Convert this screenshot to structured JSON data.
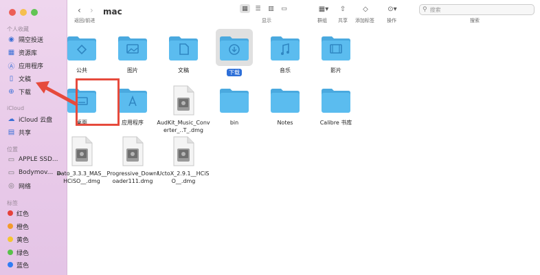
{
  "window": {
    "title": "mac"
  },
  "sidebar": {
    "sections": [
      {
        "label": "个人收藏",
        "items": [
          "隔空投送",
          "资源库",
          "应用程序",
          "文稿",
          "下载"
        ]
      },
      {
        "label": "iCloud",
        "items": [
          "iCloud 云盘",
          "共享"
        ]
      },
      {
        "label": "位置",
        "items": [
          "APPLE SSD...",
          "Bodymov...",
          "网络"
        ]
      },
      {
        "label": "标签",
        "items": [
          "红色",
          "橙色",
          "黄色",
          "绿色",
          "蓝色"
        ]
      }
    ],
    "tag_colors": [
      "#e5413a",
      "#f39a2b",
      "#f5c531",
      "#58c14a",
      "#2f7cf5"
    ]
  },
  "toolbar": {
    "back_label": "返回/前进",
    "view_label": "显示",
    "group_label": "群组",
    "share_label": "共享",
    "tag_label": "添加标签",
    "action_label": "操作",
    "search_label": "搜索",
    "search_placeholder": "搜索"
  },
  "files": [
    {
      "name": "公共",
      "kind": "folder",
      "glyph": "public"
    },
    {
      "name": "图片",
      "kind": "folder",
      "glyph": "pictures"
    },
    {
      "name": "文稿",
      "kind": "folder",
      "glyph": "documents"
    },
    {
      "name": "下载",
      "kind": "folder",
      "glyph": "downloads",
      "selected": true
    },
    {
      "name": "音乐",
      "kind": "folder",
      "glyph": "music"
    },
    {
      "name": "影片",
      "kind": "folder",
      "glyph": "movies"
    },
    {
      "name": "桌面",
      "kind": "folder",
      "glyph": "desktop"
    },
    {
      "name": "应用程序",
      "kind": "folder",
      "glyph": "applications"
    },
    {
      "name": "AudKit_Music_Converter_..T_.dmg",
      "kind": "dmg"
    },
    {
      "name": "bin",
      "kind": "folder",
      "glyph": "none"
    },
    {
      "name": "Notes",
      "kind": "folder",
      "glyph": "none"
    },
    {
      "name": "Calibre 书库",
      "kind": "folder",
      "glyph": "none"
    },
    {
      "name": "Dato_3.3.3_MAS__HCiSO__.dmg",
      "kind": "dmg"
    },
    {
      "name": "Progressive_Downloader111.dmg",
      "kind": "dmg"
    },
    {
      "name": "UctoX_2.9.1__HCiSO__.dmg",
      "kind": "dmg"
    }
  ],
  "colors": {
    "folder": "#5bbcef",
    "folder_tab": "#4aa9df",
    "folder_glyph": "#2f86c2",
    "selection": "#2d6fd8",
    "annotation": "#e64a3c"
  }
}
